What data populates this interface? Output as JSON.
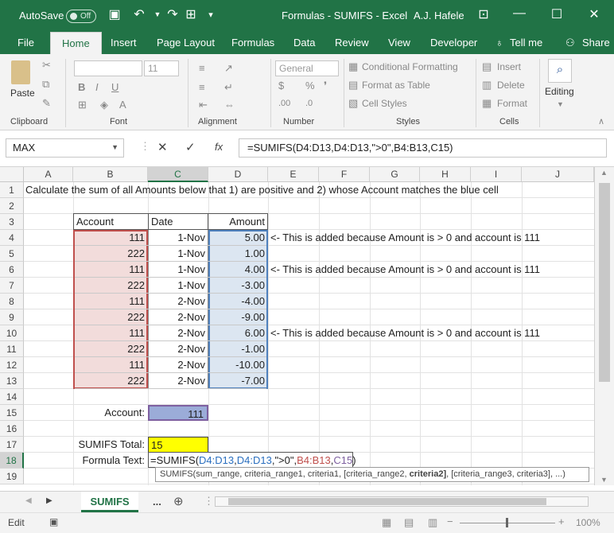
{
  "titlebar": {
    "autosave_label": "AutoSave",
    "autosave_state": "Off",
    "title": "Formulas - SUMIFS  -  Excel",
    "user": "A.J. Hafele"
  },
  "ribbon_tabs": [
    "File",
    "Home",
    "Insert",
    "Page Layout",
    "Formulas",
    "Data",
    "Review",
    "View",
    "Developer",
    "Tell me",
    "Share"
  ],
  "ribbon": {
    "paste": "Paste",
    "font_size": "11",
    "number_format": "General",
    "conditional_formatting": "Conditional Formatting",
    "format_as_table": "Format as Table",
    "cell_styles": "Cell Styles",
    "insert": "Insert",
    "delete": "Delete",
    "format": "Format",
    "editing": "Editing",
    "groups": [
      "Clipboard",
      "Font",
      "Alignment",
      "Number",
      "Styles",
      "Cells"
    ]
  },
  "formula_bar": {
    "name_box": "MAX",
    "formula": "=SUMIFS(D4:D13,D4:D13,\">0\",B4:B13,C15)"
  },
  "columns": [
    "A",
    "B",
    "C",
    "D",
    "E",
    "F",
    "G",
    "H",
    "I",
    "J"
  ],
  "rows": [
    "1",
    "2",
    "3",
    "4",
    "5",
    "6",
    "7",
    "8",
    "9",
    "10",
    "11",
    "12",
    "13",
    "14",
    "15",
    "16",
    "17",
    "18",
    "19"
  ],
  "sheet": {
    "instruction": "Calculate the sum of all Amounts below that 1) are positive and 2) whose Account matches the blue cell",
    "headers": {
      "account": "Account",
      "date": "Date",
      "amount": "Amount"
    },
    "rows": [
      {
        "account": "111",
        "date": "1-Nov",
        "amount": "5.00",
        "note": "<- This is added because Amount is > 0 and account is 111"
      },
      {
        "account": "222",
        "date": "1-Nov",
        "amount": "1.00",
        "note": ""
      },
      {
        "account": "111",
        "date": "1-Nov",
        "amount": "4.00",
        "note": "<- This is added because Amount is > 0 and account is 111"
      },
      {
        "account": "222",
        "date": "1-Nov",
        "amount": "-3.00",
        "note": ""
      },
      {
        "account": "111",
        "date": "2-Nov",
        "amount": "-4.00",
        "note": ""
      },
      {
        "account": "222",
        "date": "2-Nov",
        "amount": "-9.00",
        "note": ""
      },
      {
        "account": "111",
        "date": "2-Nov",
        "amount": "6.00",
        "note": "<- This is added because Amount is > 0 and account is 111"
      },
      {
        "account": "222",
        "date": "2-Nov",
        "amount": "-1.00",
        "note": ""
      },
      {
        "account": "111",
        "date": "2-Nov",
        "amount": "-10.00",
        "note": ""
      },
      {
        "account": "222",
        "date": "2-Nov",
        "amount": "-7.00",
        "note": ""
      }
    ],
    "account_label": "Account:",
    "account_value": "111",
    "total_label": "SUMIFS Total:",
    "total_value": "15",
    "formula_label": "Formula Text:",
    "formula_parts": {
      "p1": "=SUMIFS(",
      "p2": "D4:D13",
      "p3": ",",
      "p4": "D4:D13",
      "p5": ",\">0\",",
      "p6": "B4:B13",
      "p7": ",",
      "p8": "C15",
      "p9": ")"
    },
    "tooltip_a": "SUMIFS(sum_range, criteria_range1, criteria1, [criteria_range2, ",
    "tooltip_b": "criteria2]",
    "tooltip_c": ", [criteria_range3, criteria3], ...)"
  },
  "sheet_tabs": {
    "active": "SUMIFS",
    "more": "..."
  },
  "status": {
    "mode": "Edit",
    "zoom": "100%"
  },
  "colors": {
    "excel_green": "#217346",
    "account_fill": "#f2dcdb",
    "amount_fill": "#dce6f1",
    "account_cell": "#9bacd8",
    "total_fill": "#ffff00"
  }
}
